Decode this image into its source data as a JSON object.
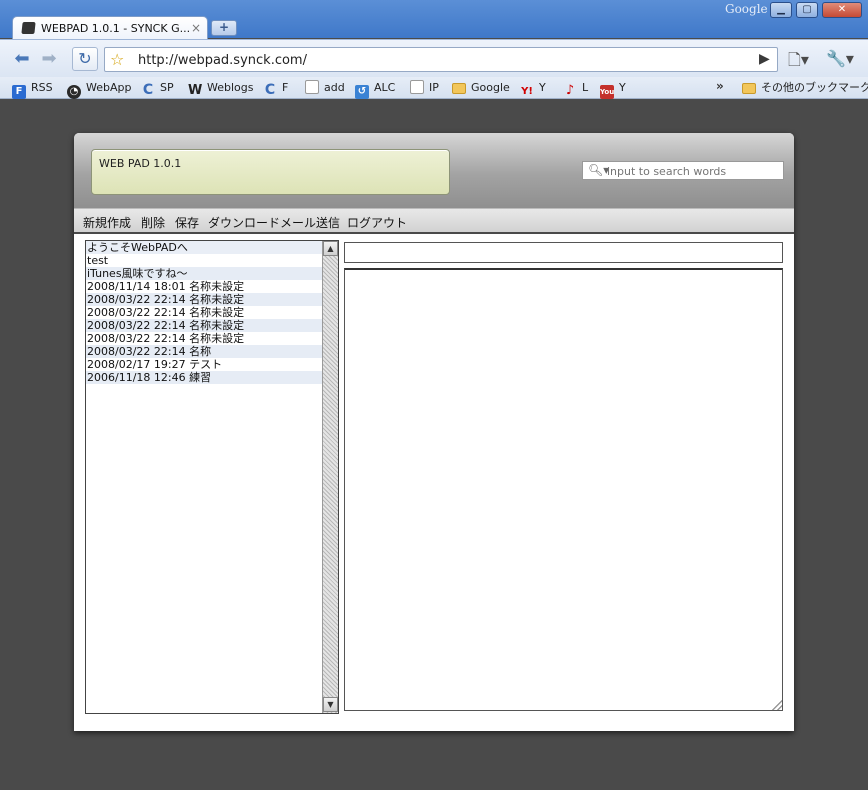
{
  "browser": {
    "google_mark": "Google",
    "tab": {
      "title": "WEBPAD 1.0.1 - SYNCK G...",
      "close": "×"
    },
    "new_tab": "+",
    "address": "http://webpad.synck.com/",
    "bookmarks": [
      {
        "label": "RSS",
        "icon": "rss-feed-icon"
      },
      {
        "label": "WebApp",
        "icon": "webapp-icon"
      },
      {
        "label": "SP",
        "icon": "refresh-c-icon"
      },
      {
        "label": "Weblogs",
        "icon": "weblogs-w-icon"
      },
      {
        "label": "F",
        "icon": "refresh-c-icon"
      },
      {
        "label": "add",
        "icon": "page-icon"
      },
      {
        "label": "ALC",
        "icon": "alc-icon"
      },
      {
        "label": "IP",
        "icon": "page-icon"
      },
      {
        "label": "Google",
        "icon": "folder-icon"
      },
      {
        "label": "Y",
        "icon": "yahoo-icon"
      },
      {
        "label": "L",
        "icon": "l-icon"
      },
      {
        "label": "Y",
        "icon": "youtube-icon"
      }
    ],
    "more": "»",
    "other_bookmarks": "その他のブックマーク"
  },
  "app": {
    "title": "WEB PAD 1.0.1",
    "search_placeholder": "input to search words",
    "menu": [
      "新規作成",
      "削除",
      "保存",
      "ダウンロード",
      "メール送信",
      "ログアウト"
    ],
    "notes": [
      "ようこそWebPADへ",
      "test",
      "iTunes風味ですね〜",
      "2008/11/14 18:01 名称未設定",
      "2008/03/22 22:14 名称未設定",
      "2008/03/22 22:14 名称未設定",
      "2008/03/22 22:14 名称未設定",
      "2008/03/22 22:14 名称未設定",
      "2008/03/22 22:14 名称",
      "2008/02/17 19:27 テスト",
      "2006/11/18 12:46 練習"
    ],
    "note_title_value": "",
    "note_body_value": ""
  },
  "colors": {
    "page_background": "#4a4a4a",
    "title_box": "#dde3b6",
    "list_alt_row": "#e6ecf5"
  }
}
